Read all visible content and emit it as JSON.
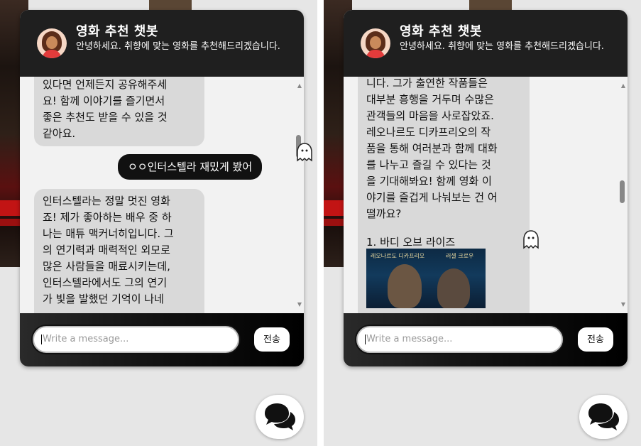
{
  "left_panel": {
    "chat": {
      "title": "영화 추천 챗봇",
      "subtitle": "안녕하세요. 취향에 맞는 영화를 추천해드리겠습니다.",
      "messages": {
        "bot_1_lines": [
          "있다면 언제든지 공유해주세",
          "요! 함께 이야기를 즐기면서",
          "좋은 추천도 받을 수 있을 것",
          "같아요."
        ],
        "user_1": "ㅇㅇ인터스텔라 재밌게 봤어",
        "bot_2_lines": [
          "인터스텔라는 정말 멋진 영화",
          "죠! 제가 좋아하는 배우 중 하",
          "나는 매튜 맥커너히입니다. 그",
          "의 연기력과 매력적인 외모로",
          "많은 사람들을 매료시키는데,",
          "인터스텔라에서도 그의 연기",
          "가 빛을 발했던 기억이 나네"
        ]
      },
      "input_placeholder": "Write a message...",
      "send_label": "전송"
    }
  },
  "right_panel": {
    "chat": {
      "title": "영화 추천 챗봇",
      "subtitle": "안녕하세요. 취향에 맞는 영화를 추천해드리겠습니다.",
      "messages": {
        "bot_lines": [
          "니다. 그가 출연한 작품들은",
          "대부분 흥행을 거두며 수많은",
          "관객들의 마음을 사로잡았죠.",
          "레오나르도 디카프리오의 작",
          "품을 통해 여러분과 함께 대화",
          "를 나누고 즐길 수 있다는 것",
          "을 기대해봐요! 함께 영화 이",
          "야기를 즐겁게 나눠보는 건 어",
          "떨까요?"
        ],
        "recommendation_title": "1. 바디 오브 라이즈",
        "poster_text_left": "레오나르도 디카프리오",
        "poster_text_right": "러셀 크로우"
      },
      "input_placeholder": "Write a message...",
      "send_label": "전송"
    }
  },
  "colors": {
    "header_bg": "#1f1f1f",
    "bot_bubble": "#d9d9d9",
    "user_bubble": "#111111",
    "page_bg": "#e6e6e6"
  },
  "icons": [
    "avatar-icon",
    "ghost-icon",
    "chat-bubbles-icon"
  ]
}
